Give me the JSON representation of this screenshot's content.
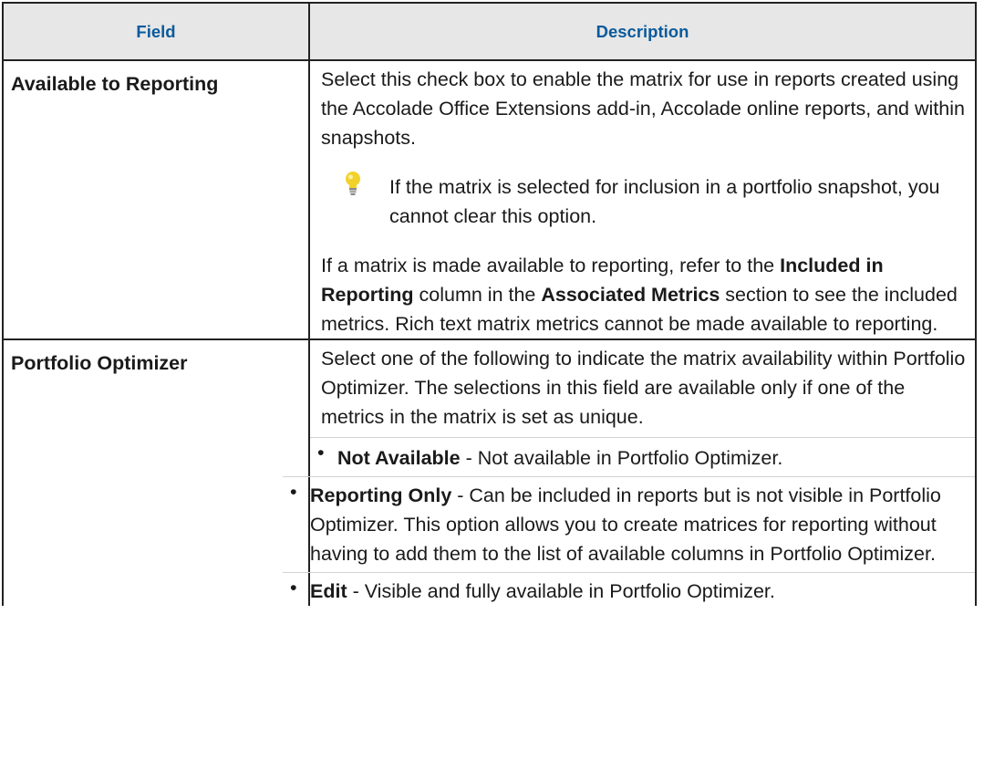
{
  "table": {
    "headers": {
      "field": "Field",
      "description": "Description"
    },
    "rows": [
      {
        "field": "Available to Reporting",
        "desc_intro": "Select this check box to enable the matrix for use in reports created using the Accolade Office Extensions add-in, Accolade online reports, and within snapshots.",
        "tip": "If the matrix is selected for inclusion in a portfolio snapshot, you cannot clear this option.",
        "para2": {
          "t1": "If a matrix is made available to reporting, refer to the ",
          "b1": "Included in Reporting",
          "t2": " column in the ",
          "b2": "Associated Metrics",
          "t3": " section to see the included metrics. Rich text matrix metrics cannot be made available to reporting."
        }
      },
      {
        "field": "Portfolio Optimizer",
        "desc_intro": "Select one of the following to indicate the matrix availability within Portfolio Optimizer. The selections in this field are available only if one of the metrics in the matrix is set as unique.",
        "options": [
          {
            "name": "Not Available",
            "text": " - Not available in Portfolio Optimizer."
          },
          {
            "name": "Reporting Only",
            "text": " - Can be included in reports but is not visible in Portfolio Optimizer. This option allows you to create matrices for reporting without having to add them to the list of available columns in Portfolio Optimizer."
          },
          {
            "name": "Edit",
            "text": " - Visible and fully available in Portfolio Optimizer."
          }
        ]
      }
    ]
  },
  "icons": {
    "tip_icon": "lightbulb-icon",
    "bullet": "•"
  },
  "colors": {
    "header_text": "#0a5a9c",
    "header_bg": "#e7e7e7",
    "bulb": "#f2d22a"
  }
}
